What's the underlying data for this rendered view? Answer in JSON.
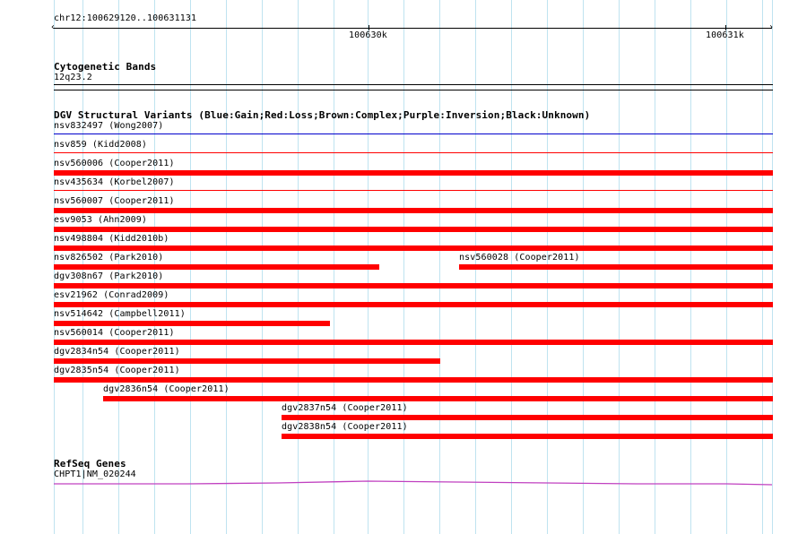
{
  "ruler": {
    "range_label": "chr12:100629120..100631131",
    "start": 100629120,
    "end": 100631131,
    "ticks": [
      {
        "pos": 100630000,
        "label": "100630k"
      },
      {
        "pos": 100631000,
        "label": "100631k"
      }
    ]
  },
  "tracks": {
    "cytoband": {
      "title": "Cytogenetic Bands",
      "band_label": "12q23.2"
    },
    "dgv": {
      "title": "DGV Structural Variants (Blue:Gain;Red:Loss;Brown:Complex;Purple:Inversion;Black:Unknown)",
      "colors": {
        "loss": "#ff0000",
        "gain": "#0000cc"
      },
      "rows": [
        [
          {
            "label": "nsv832497 (Wong2007)",
            "start": 100629120,
            "end": 100631131,
            "type": "gain",
            "style": "thin"
          }
        ],
        [
          {
            "label": "nsv859 (Kidd2008)",
            "start": 100629120,
            "end": 100631131,
            "type": "loss",
            "style": "thin"
          }
        ],
        [
          {
            "label": "nsv560006 (Cooper2011)",
            "start": 100629120,
            "end": 100631131,
            "type": "loss",
            "style": "bar"
          }
        ],
        [
          {
            "label": "nsv435634 (Korbel2007)",
            "start": 100629120,
            "end": 100631131,
            "type": "loss",
            "style": "thin"
          }
        ],
        [
          {
            "label": "nsv560007 (Cooper2011)",
            "start": 100629120,
            "end": 100631131,
            "type": "loss",
            "style": "bar"
          }
        ],
        [
          {
            "label": "esv9053 (Ahn2009)",
            "start": 100629120,
            "end": 100631131,
            "type": "loss",
            "style": "bar"
          }
        ],
        [
          {
            "label": "nsv498804 (Kidd2010b)",
            "start": 100629120,
            "end": 100631131,
            "type": "loss",
            "style": "bar"
          }
        ],
        [
          {
            "label": "nsv826502 (Park2010)",
            "start": 100629120,
            "end": 100630030,
            "type": "loss",
            "style": "bar"
          },
          {
            "label": "nsv560028 (Cooper2011)",
            "start": 100630255,
            "end": 100631131,
            "type": "loss",
            "style": "bar"
          }
        ],
        [
          {
            "label": "dgv308n67 (Park2010)",
            "start": 100629120,
            "end": 100631131,
            "type": "loss",
            "style": "bar"
          }
        ],
        [
          {
            "label": "esv21962 (Conrad2009)",
            "start": 100629120,
            "end": 100631131,
            "type": "loss",
            "style": "bar"
          }
        ],
        [
          {
            "label": "nsv514642 (Campbell2011)",
            "start": 100629120,
            "end": 100629890,
            "type": "loss",
            "style": "bar"
          }
        ],
        [
          {
            "label": "nsv560014 (Cooper2011)",
            "start": 100629120,
            "end": 100631131,
            "type": "loss",
            "style": "bar"
          }
        ],
        [
          {
            "label": "dgv2834n54 (Cooper2011)",
            "start": 100629120,
            "end": 100630200,
            "type": "loss",
            "style": "bar"
          }
        ],
        [
          {
            "label": "dgv2835n54 (Cooper2011)",
            "start": 100629120,
            "end": 100631131,
            "type": "loss",
            "style": "bar"
          }
        ],
        [
          {
            "label": "dgv2836n54 (Cooper2011)",
            "start": 100629258,
            "end": 100631131,
            "type": "loss",
            "style": "bar"
          }
        ],
        [
          {
            "label": "dgv2837n54 (Cooper2011)",
            "start": 100629758,
            "end": 100631131,
            "type": "loss",
            "style": "bar"
          }
        ],
        [
          {
            "label": "dgv2838n54 (Cooper2011)",
            "start": 100629758,
            "end": 100631131,
            "type": "loss",
            "style": "bar"
          }
        ]
      ]
    },
    "refseq": {
      "title": "RefSeq Genes",
      "gene_label": "CHPT1|NM_020244",
      "color": "#c040c0"
    }
  }
}
